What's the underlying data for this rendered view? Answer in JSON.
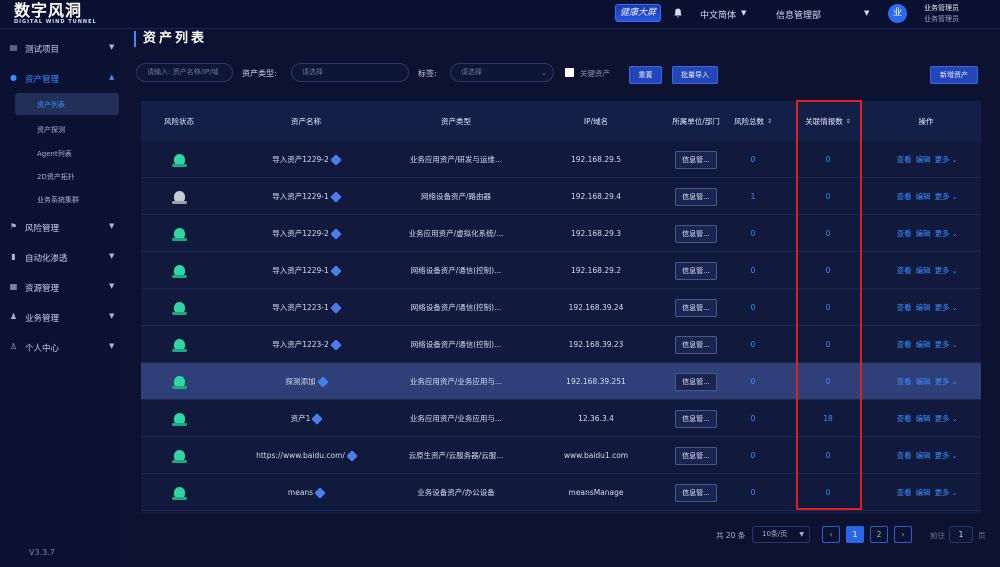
{
  "header": {
    "logo_title": "数字风洞",
    "logo_subtitle": "DIGITAL WIND TUNNEL",
    "big_screen": "健康大屏",
    "language": "中文简体",
    "department": "信息管理部",
    "avatar_text": "业",
    "user_name": "业务管理员",
    "user_role": "业务管理员"
  },
  "sidebar": {
    "items": [
      {
        "label": "测试项目",
        "icon": "clipboard-icon"
      },
      {
        "label": "资产管理",
        "icon": "location-pin-icon"
      },
      {
        "label": "风险管理",
        "icon": "flag-icon"
      },
      {
        "label": "自动化渗透",
        "icon": "bar-chart-icon"
      },
      {
        "label": "资源管理",
        "icon": "grid-icon"
      },
      {
        "label": "业务管理",
        "icon": "user-icon"
      },
      {
        "label": "个人中心",
        "icon": "person-icon"
      }
    ],
    "sub_items": [
      "资产列表",
      "资产探测",
      "Agent列表",
      "2D资产拓扑",
      "业务系统集群"
    ],
    "version": "V3.3.7"
  },
  "page": {
    "title": "资产列表"
  },
  "filters": {
    "search_placeholder": "请输入: 资产名称/IP/域",
    "type_label": "资产类型:",
    "type_placeholder": "请选择",
    "tag_label": "标签:",
    "tag_placeholder": "请选择",
    "key_asset_label": "关键资产",
    "reset": "重置",
    "batch_import": "批量导入",
    "add_asset": "新增资产"
  },
  "table": {
    "headers": [
      "风险状态",
      "资产名称",
      "资产类型",
      "IP/域名",
      "所属单位/部门",
      "风险总数",
      "关联情报数",
      "操作"
    ],
    "op_view": "查看",
    "op_edit": "编辑",
    "op_more": "更多",
    "dept_label": "信息管...",
    "rows": [
      {
        "risk": "green",
        "name": "导入资产1229-2",
        "type": "业务应用资产/研发与运维...",
        "ip": "192.168.29.5",
        "dept": "信息管...",
        "risk_total": "0",
        "intel": "0"
      },
      {
        "risk": "gray",
        "name": "导入资产1229-1",
        "type": "网络设备资产/路由器",
        "ip": "192.168.29.4",
        "dept": "信息管...",
        "risk_total": "1",
        "intel": "0"
      },
      {
        "risk": "green",
        "name": "导入资产1229-2",
        "type": "业务应用资产/虚拟化系统/...",
        "ip": "192.168.29.3",
        "dept": "信息管...",
        "risk_total": "0",
        "intel": "0"
      },
      {
        "risk": "green",
        "name": "导入资产1229-1",
        "type": "网络设备资产/通信(控制)...",
        "ip": "192.168.29.2",
        "dept": "信息管...",
        "risk_total": "0",
        "intel": "0"
      },
      {
        "risk": "green",
        "name": "导入资产1223-1",
        "type": "网络设备资产/通信(控制)...",
        "ip": "192.168.39.24",
        "dept": "信息管...",
        "risk_total": "0",
        "intel": "0"
      },
      {
        "risk": "green",
        "name": "导入资产1223-2",
        "type": "网络设备资产/通信(控制)...",
        "ip": "192.168.39.23",
        "dept": "信息管...",
        "risk_total": "0",
        "intel": "0"
      },
      {
        "risk": "green",
        "name": "探测添加",
        "type": "业务应用资产/业务应用与...",
        "ip": "192.168.39.251",
        "dept": "信息管...",
        "risk_total": "0",
        "intel": "0"
      },
      {
        "risk": "green",
        "name": "资产1",
        "type": "业务应用资产/业务应用与...",
        "ip": "12.36.3.4",
        "dept": "信息管...",
        "risk_total": "0",
        "intel": "18"
      },
      {
        "risk": "green",
        "name": "https://www.baidu.com/",
        "type": "云原生资产/云服务器/云服...",
        "ip": "www.baidu1.com",
        "dept": "信息管...",
        "risk_total": "0",
        "intel": "0"
      },
      {
        "risk": "green",
        "name": "means",
        "type": "业务设备资产/办公设备",
        "ip": "meansManage",
        "dept": "信息管...",
        "risk_total": "0",
        "intel": "0"
      }
    ]
  },
  "pagination": {
    "total": "共 20 条",
    "page_size": "10条/页",
    "pages": [
      "1",
      "2"
    ],
    "goto_label": "前往",
    "goto_value": "1",
    "goto_unit": "页"
  },
  "colors": {
    "accent": "#3b8dff",
    "highlight_box": "#e0201c",
    "risk_ok": "#2fd6a4"
  }
}
